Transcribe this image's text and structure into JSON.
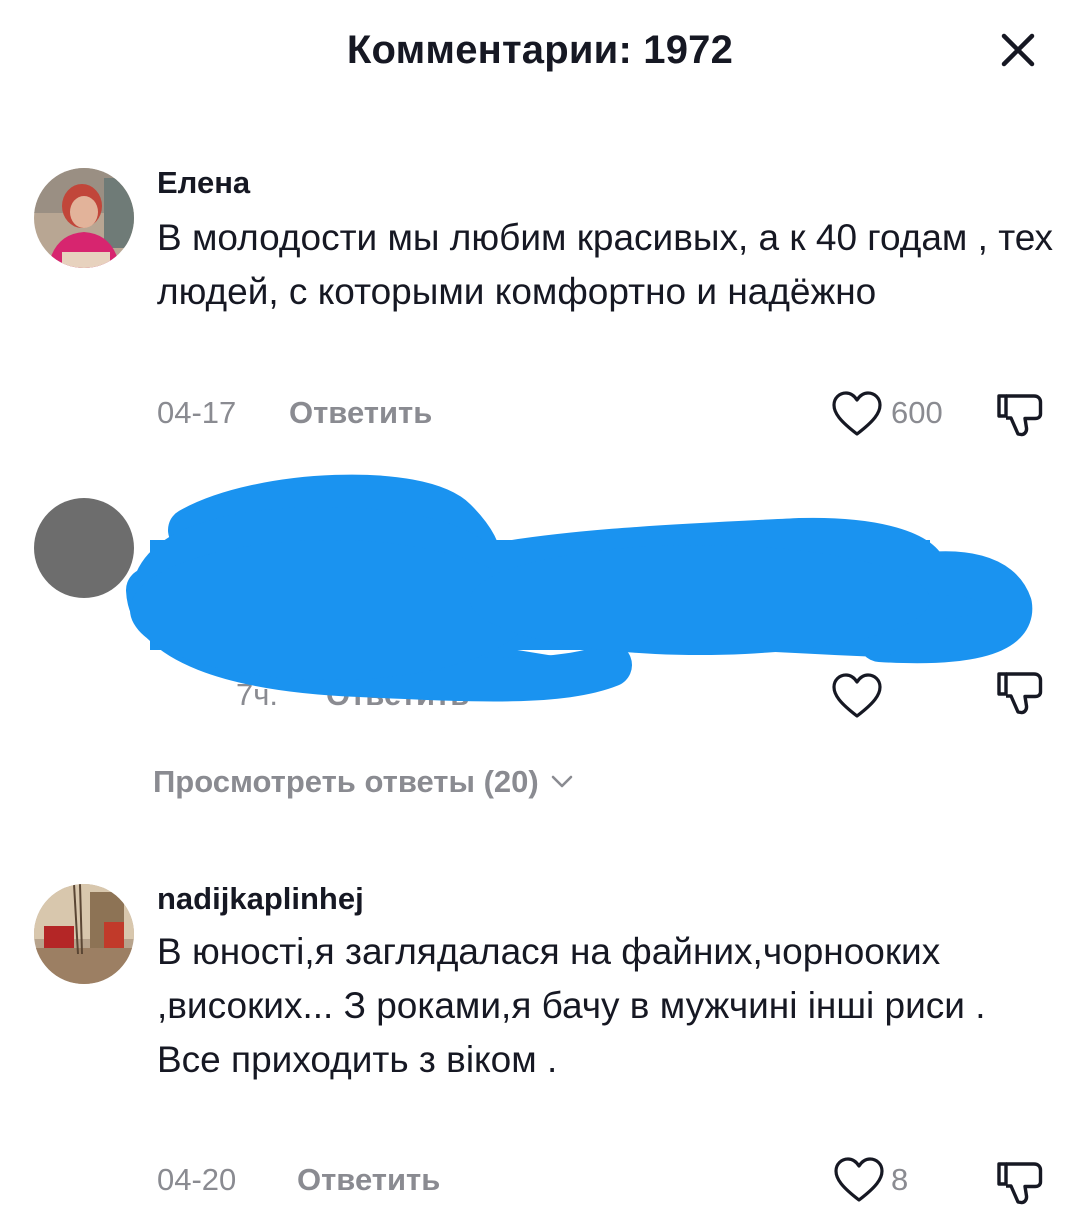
{
  "header": {
    "title": "Комментарии: 1972"
  },
  "comments": [
    {
      "username": "Елена",
      "text": "В молодости мы любим красивых, а к 40 годам , тех людей, с которыми комфортно и надёжно",
      "date": "04-17",
      "reply_label": "Ответить",
      "likes": "600"
    },
    {
      "username": "",
      "text": "",
      "date": "7ч.",
      "reply_label": "Ответить",
      "likes": "",
      "redacted": true
    },
    {
      "username": "nadijkaplinhej",
      "text": "В юності,я заглядалася на файних,чорнооких ,високих... З роками,я бачу в мужчині інші риси . Все приходить з віком .",
      "date": "04-20",
      "reply_label": "Ответить",
      "likes": "8"
    }
  ],
  "view_replies": {
    "label": "Просмотреть ответы (20)"
  },
  "colors": {
    "text": "#161823",
    "muted": "#8a8b91",
    "redaction": "#1a93f0"
  }
}
